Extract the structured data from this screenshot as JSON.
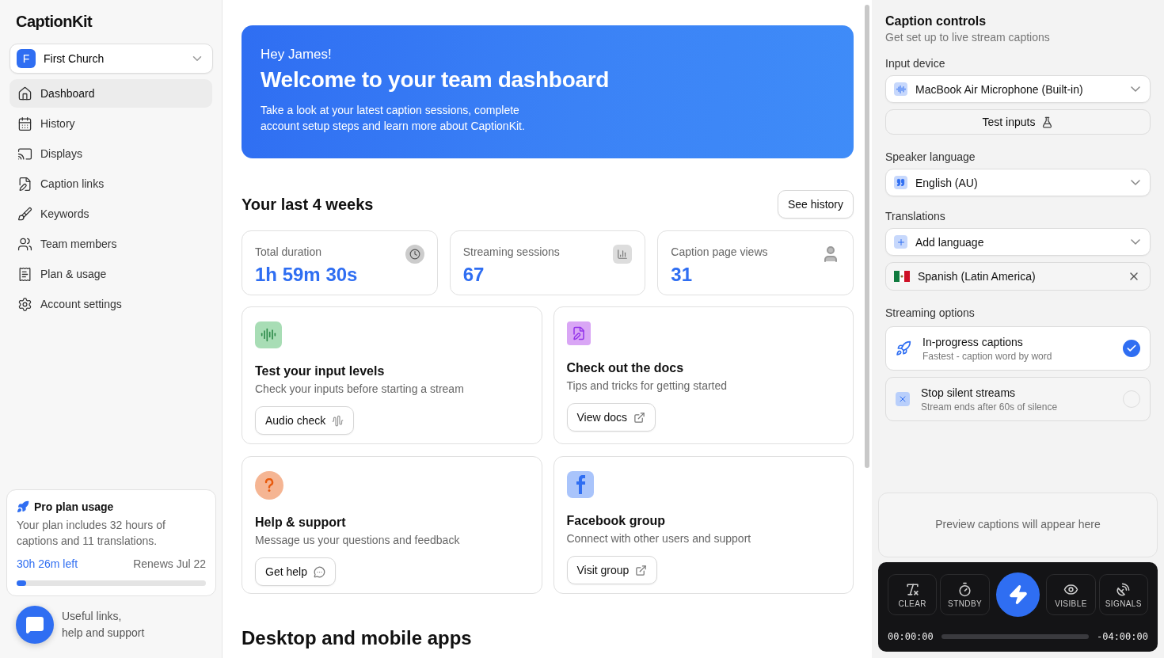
{
  "sidebar": {
    "logo": "CaptionKit",
    "workspace": {
      "initial": "F",
      "name": "First Church"
    },
    "items": [
      {
        "label": "Dashboard",
        "selected": true
      },
      {
        "label": "History",
        "selected": false
      },
      {
        "label": "Displays",
        "selected": false
      },
      {
        "label": "Caption links",
        "selected": false
      },
      {
        "label": "Keywords",
        "selected": false
      },
      {
        "label": "Team members",
        "selected": false
      },
      {
        "label": "Plan & usage",
        "selected": false
      },
      {
        "label": "Account settings",
        "selected": false
      }
    ],
    "plan": {
      "title": "Pro plan usage",
      "text": "Your plan includes 32 hours of captions and 11 translations.",
      "left": "30h 26m left",
      "renews": "Renews Jul 22",
      "level": 0.05
    },
    "help": {
      "text": "Useful links,\nhelp and support"
    }
  },
  "main": {
    "hero": {
      "greeting": "Hey James!",
      "title": "Welcome to your team dashboard",
      "text": "Take a look at your latest caption sessions, complete account setup steps and learn more about CaptionKit."
    },
    "stats_title": "Your last 4 weeks",
    "see_history": "See history",
    "stats": [
      {
        "label": "Total duration",
        "value": "1h 59m 30s"
      },
      {
        "label": "Streaming sessions",
        "value": "67"
      },
      {
        "label": "Caption page views",
        "value": "31"
      }
    ],
    "cards": [
      {
        "title": "Test your input levels",
        "text": "Check your inputs before starting a stream",
        "button": "Audio check"
      },
      {
        "title": "Check out the docs",
        "text": "Tips and tricks for getting started",
        "button": "View docs"
      },
      {
        "title": "Help & support",
        "text": "Message us your questions and feedback",
        "button": "Get help"
      },
      {
        "title": "Facebook group",
        "text": "Connect with other users and support",
        "button": "Visit group"
      }
    ],
    "apps_title": "Desktop and mobile apps"
  },
  "controls": {
    "title": "Caption controls",
    "subtitle": "Get set up to live stream captions",
    "input_label": "Input device",
    "input_device": "MacBook Air Microphone (Built-in)",
    "test_inputs": "Test inputs",
    "speaker_label": "Speaker language",
    "speaker_language": "English (AU)",
    "translations_label": "Translations",
    "add_language": "Add language",
    "translations": [
      {
        "name": "Spanish (Latin America)"
      }
    ],
    "streaming_label": "Streaming options",
    "options": [
      {
        "title": "In-progress captions",
        "text": "Fastest - caption word by word",
        "checked": true
      },
      {
        "title": "Stop silent streams",
        "text": "Stream ends after 60s of silence",
        "checked": false
      }
    ],
    "preview": "Preview captions will appear here",
    "left_buttons": [
      "CLEAR",
      "STNDBY"
    ],
    "right_buttons": [
      "VISIBLE",
      "SIGNALS"
    ],
    "elapsed": "00:00:00",
    "remaining": "-04:00:00"
  }
}
